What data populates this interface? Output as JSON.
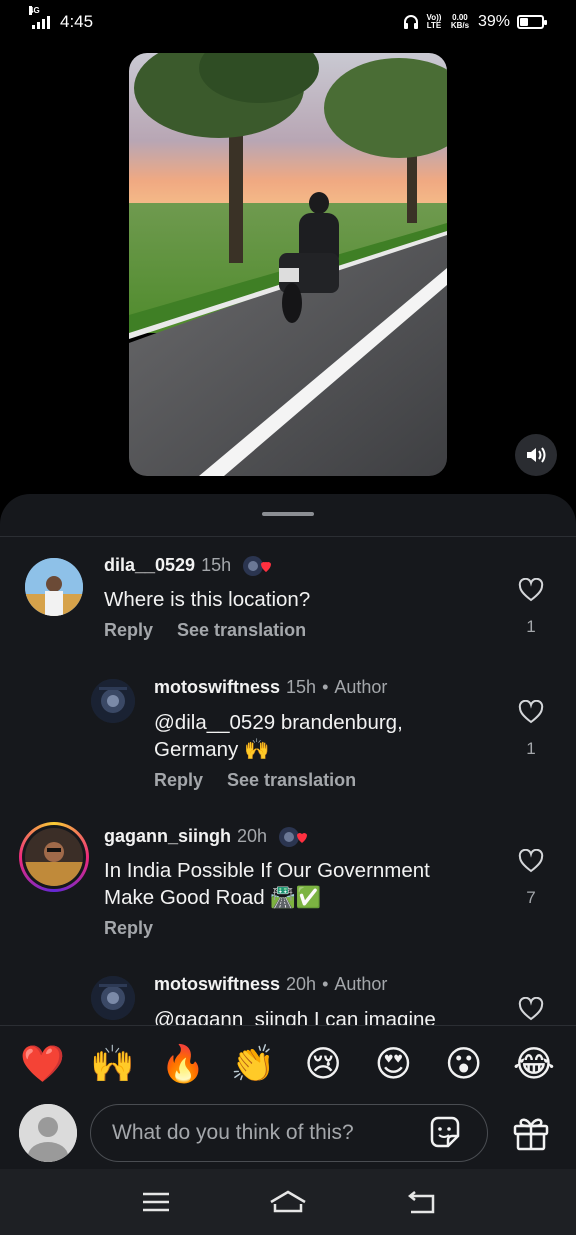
{
  "status_bar": {
    "network": "4G",
    "time": "4:45",
    "volte": "Vo)) LTE",
    "speed": "0.00 KB/s",
    "battery": "39%",
    "battery_level": 0.39
  },
  "video": {
    "sound_icon": "speaker-icon"
  },
  "comments": [
    {
      "username": "dila__0529",
      "time": "15h",
      "text": "Where is this location?",
      "actions": [
        "Reply",
        "See translation"
      ],
      "likes": "1"
    },
    {
      "username": "motoswiftness",
      "time": "15h",
      "author_label": "Author",
      "text_lines": [
        "@dila__0529 brandenburg,",
        "Germany 🙌"
      ],
      "actions": [
        "Reply",
        "See translation"
      ],
      "likes": "1"
    },
    {
      "username": "gagann_siingh",
      "time": "20h",
      "text_lines": [
        "In India Possible If Our Government",
        "Make Good Road 🛣️✅"
      ],
      "actions": [
        "Reply"
      ],
      "likes": "7"
    },
    {
      "username": "motoswiftness",
      "time": "20h",
      "author_label": "Author",
      "text": "@gagann_siingh I can imagine"
    }
  ],
  "reactions": [
    "❤️",
    "🙌",
    "🔥",
    "👏",
    "😢",
    "😍",
    "😮",
    "😂"
  ],
  "composer": {
    "placeholder": "What do you think of this?"
  },
  "colors": {
    "background": "#000000",
    "sheet": "#16181c",
    "secondary_text": "#a4a7ab",
    "like_heart_badge": "#ff3040"
  }
}
